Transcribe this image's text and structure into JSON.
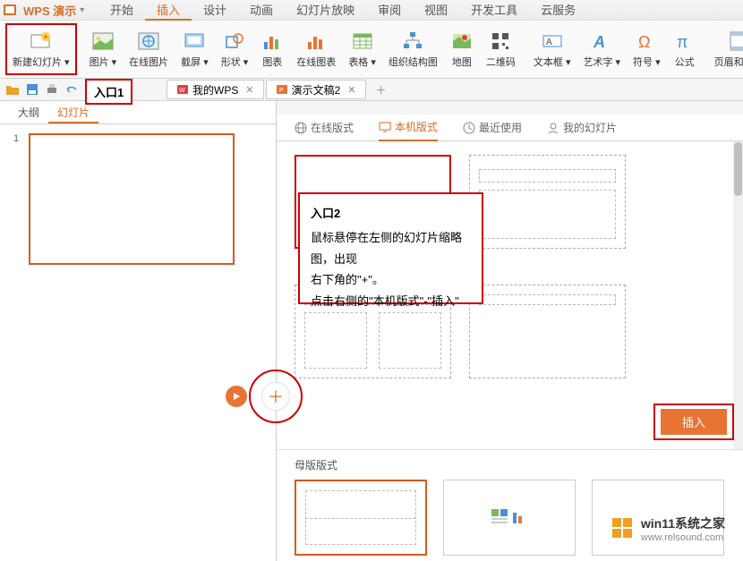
{
  "app": {
    "name": "WPS 演示"
  },
  "menuTabs": [
    "开始",
    "插入",
    "设计",
    "动画",
    "幻灯片放映",
    "审阅",
    "视图",
    "开发工具",
    "云服务"
  ],
  "activeMenuTab": 1,
  "ribbon": {
    "newSlide": "新建幻灯片",
    "image": "图片",
    "onlineImage": "在线图片",
    "screenshot": "截屏",
    "shape": "形状",
    "chart": "图表",
    "onlineChart": "在线图表",
    "table": "表格",
    "orgChart": "组织结构图",
    "map": "地图",
    "qrcode": "二维码",
    "textbox": "文本框",
    "wordart": "艺术字",
    "symbol": "符号",
    "formula": "公式",
    "headerFooter": "页眉和页脚"
  },
  "annotations": {
    "entry1": "入口1",
    "entry2": {
      "title": "入口2",
      "line1": "鼠标悬停在左侧的幻灯片缩略图，出现",
      "line2": "右下角的\"+\"。",
      "line3": "点击右侧的\"本机版式\"-\"插入\""
    }
  },
  "docTabs": [
    {
      "label": "我的WPS"
    },
    {
      "label": "演示文稿2"
    }
  ],
  "leftPanel": {
    "tabs": [
      "大纲",
      "幻灯片"
    ],
    "activeTab": 1,
    "slideNum": "1"
  },
  "templateTabs": {
    "online": "在线版式",
    "local": "本机版式",
    "recent": "最近使用",
    "mySlides": "我的幻灯片"
  },
  "insertBtn": "插入",
  "masterTitle": "母版版式",
  "watermark": {
    "title": "win11系统之家",
    "url": "www.relsound.com"
  }
}
